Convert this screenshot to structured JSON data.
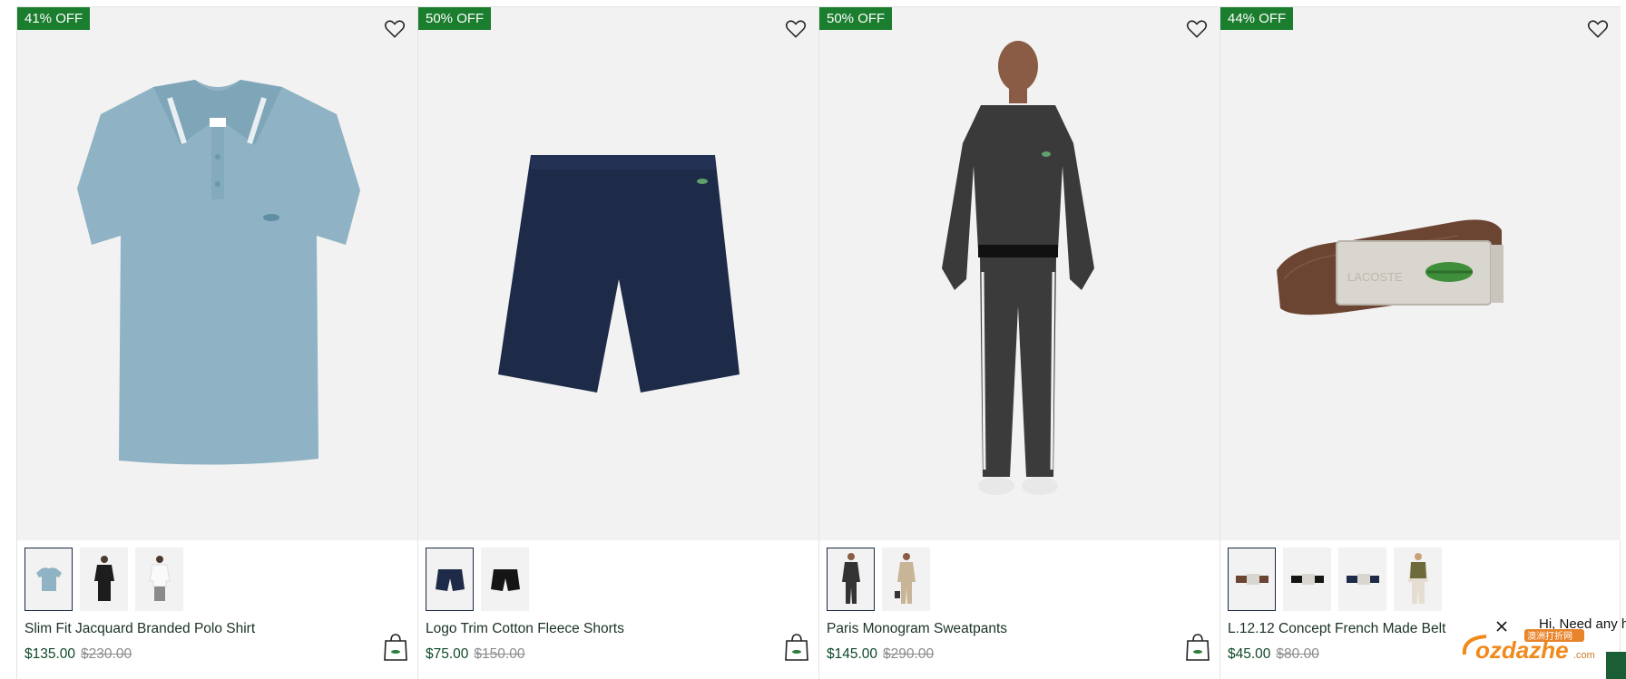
{
  "products": [
    {
      "badge": "41% OFF",
      "name": "Slim Fit Jacquard Branded Polo Shirt",
      "price": "$135.00",
      "original_price": "$230.00",
      "image": "light-blue-polo-shirt",
      "swatches": [
        "light-blue",
        "black",
        "white"
      ],
      "selected_swatch": 0
    },
    {
      "badge": "50% OFF",
      "name": "Logo Trim Cotton Fleece Shorts",
      "price": "$75.00",
      "original_price": "$150.00",
      "image": "navy-fleece-shorts",
      "swatches": [
        "navy",
        "black"
      ],
      "selected_swatch": 0
    },
    {
      "badge": "50% OFF",
      "name": "Paris Monogram Sweatpants",
      "price": "$145.00",
      "original_price": "$290.00",
      "image": "model-in-monogram-tracksuit",
      "swatches": [
        "black-monogram",
        "beige"
      ],
      "selected_swatch": 0
    },
    {
      "badge": "44% OFF",
      "name": "L.12.12 Concept French Made Belt",
      "price": "$45.00",
      "original_price": "$80.00",
      "image": "brown-belt-with-buckle",
      "buckle_text": "LACOSTE",
      "swatches": [
        "brown",
        "black",
        "navy",
        "khaki-model"
      ],
      "selected_swatch": 0
    }
  ],
  "icons": {
    "wishlist": "heart-outline-icon",
    "add_to_bag": "shopping-bag-icon",
    "close": "close-icon"
  },
  "chat": {
    "text": "Hi, Need any h"
  },
  "watermark": {
    "main": "ozdazhe",
    "suffix": ".com",
    "chinese": "澳洲打折网"
  },
  "colors": {
    "badge": "#1b7d2e",
    "price": "#0d4a28",
    "old_price": "#8c8c8c",
    "image_bg": "#f2f2f2"
  }
}
